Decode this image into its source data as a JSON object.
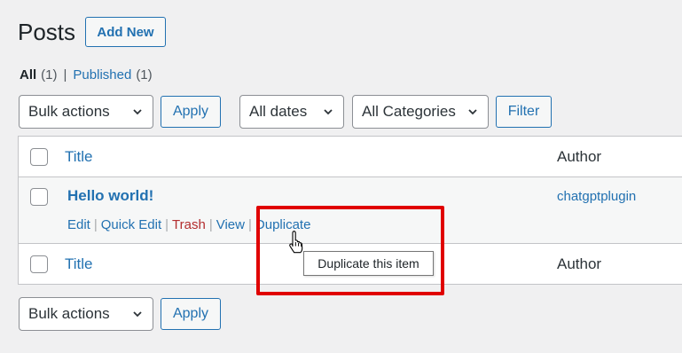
{
  "header": {
    "title": "Posts",
    "add_new_label": "Add New"
  },
  "views": {
    "all_label": "All",
    "all_count": "(1)",
    "separator": "|",
    "published_label": "Published",
    "published_count": "(1)"
  },
  "top_filters": {
    "bulk_actions_value": "Bulk actions",
    "apply_label": "Apply",
    "dates_value": "All dates",
    "categories_value": "All Categories",
    "filter_label": "Filter"
  },
  "table": {
    "columns": {
      "title": "Title",
      "author": "Author"
    },
    "rows": [
      {
        "title": "Hello world!",
        "author": "chatgptplugin",
        "actions": {
          "edit": "Edit",
          "quick_edit": "Quick Edit",
          "trash": "Trash",
          "view": "View",
          "duplicate": "Duplicate",
          "separator": "|"
        }
      }
    ]
  },
  "tooltip": {
    "text": "Duplicate this item"
  },
  "bottom_filters": {
    "bulk_actions_value": "Bulk actions",
    "apply_label": "Apply"
  },
  "colors": {
    "accent": "#2271b1",
    "trash": "#b32d2e",
    "highlight": "#e00000",
    "background": "#f0f0f1"
  }
}
